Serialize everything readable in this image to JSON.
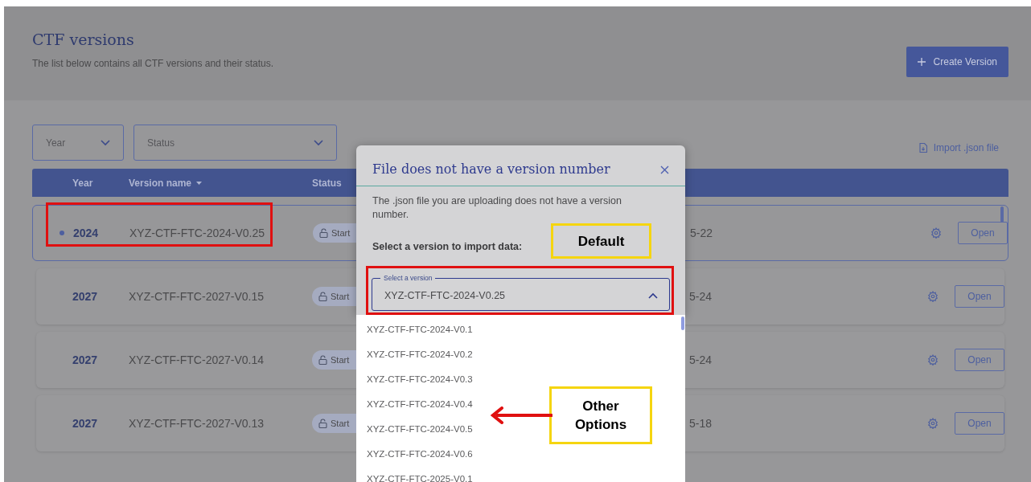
{
  "page": {
    "title": "CTF versions",
    "subtitle": "The list below contains all CTF versions and their status.",
    "create_button": "Create Version",
    "import_link": "Import .json file"
  },
  "filters": [
    {
      "label": "Year"
    },
    {
      "label": "Status"
    }
  ],
  "table": {
    "columns": [
      "Year",
      "Version name",
      "Status"
    ],
    "rows": [
      {
        "year": "2024",
        "name": "XYZ-CTF-FTC-2024-V0.25",
        "status": "Start",
        "date": "5-22",
        "selected": true,
        "action": "Open"
      },
      {
        "year": "2027",
        "name": "XYZ-CTF-FTC-2027-V0.15",
        "status": "Start",
        "date": "5-24",
        "selected": false,
        "action": "Open"
      },
      {
        "year": "2027",
        "name": "XYZ-CTF-FTC-2027-V0.14",
        "status": "Start",
        "date": "5-24",
        "selected": false,
        "action": "Open"
      },
      {
        "year": "2027",
        "name": "XYZ-CTF-FTC-2027-V0.13",
        "status": "Start",
        "date": "5-18",
        "selected": false,
        "action": "Open"
      }
    ]
  },
  "dialog": {
    "title": "File does not have a version number",
    "message": "The .json file you are uploading does not have a version number.",
    "prompt": "Select a version to import data:",
    "select": {
      "label": "Select a version",
      "value": "XYZ-CTF-FTC-2024-V0.25",
      "expanded": true
    },
    "options": [
      "XYZ-CTF-FTC-2024-V0.1",
      "XYZ-CTF-FTC-2024-V0.2",
      "XYZ-CTF-FTC-2024-V0.3",
      "XYZ-CTF-FTC-2024-V0.4",
      "XYZ-CTF-FTC-2024-V0.5",
      "XYZ-CTF-FTC-2024-V0.6",
      "XYZ-CTF-FTC-2025-V0.1"
    ]
  },
  "annotations": [
    {
      "kind": "callout",
      "text": "Default"
    },
    {
      "kind": "callout",
      "text": "Other Options"
    }
  ]
}
